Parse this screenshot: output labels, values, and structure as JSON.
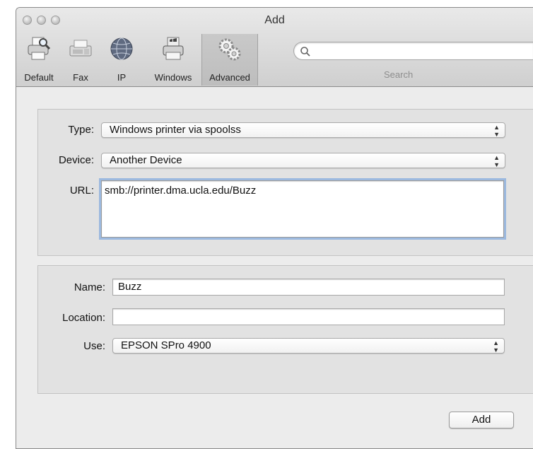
{
  "window": {
    "title": "Add"
  },
  "toolbar": {
    "items": [
      {
        "label": "Default",
        "icon": "default-printer-icon"
      },
      {
        "label": "Fax",
        "icon": "fax-icon"
      },
      {
        "label": "IP",
        "icon": "ip-globe-icon"
      },
      {
        "label": "Windows",
        "icon": "windows-printer-icon"
      },
      {
        "label": "Advanced",
        "icon": "advanced-gear-icon",
        "selected": true
      }
    ],
    "search_label": "Search",
    "search_value": ""
  },
  "device_panel": {
    "type_label": "Type:",
    "type_value": "Windows printer via spoolss",
    "device_label": "Device:",
    "device_value": "Another Device",
    "url_label": "URL:",
    "url_value": "smb://printer.dma.ucla.edu/Buzz"
  },
  "info_panel": {
    "name_label": "Name:",
    "name_value": "Buzz",
    "location_label": "Location:",
    "location_value": "",
    "use_label": "Use:",
    "use_value": "EPSON SPro 4900"
  },
  "footer": {
    "add_label": "Add"
  },
  "colors": {
    "window_bg": "#ececec",
    "panel_bg": "#e2e2e2",
    "focus_ring": "#9cb9df"
  }
}
